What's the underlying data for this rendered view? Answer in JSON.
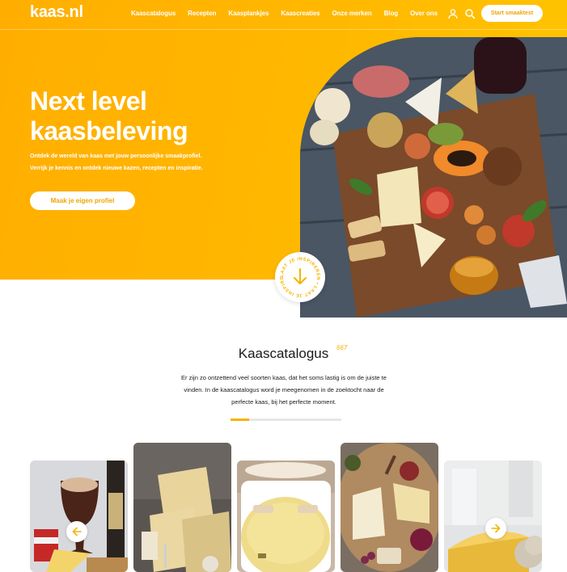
{
  "header": {
    "logo": "kaas.nl",
    "nav": [
      "Kaascatalogus",
      "Recepten",
      "Kaasplankjes",
      "Kaascreaties",
      "Onze merken",
      "Blog",
      "Over ons"
    ],
    "cta_label": "Start smaaktest",
    "icons": [
      "user-icon",
      "search-icon"
    ]
  },
  "hero": {
    "title_line1": "Next level",
    "title_line2": "kaasbeleving",
    "text": "Ontdek de wereld van kaas met jouw persoonlijke smaakprofiel. Verrijk je kennis en ontdek nieuwe kazen, recepten en inspiratie.",
    "button_label": "Maak je eigen profiel",
    "badge_text": "LAAT JE INSPIREREN • LAAT JE INSPIREREN • "
  },
  "catalog": {
    "title": "Kaascatalogus",
    "count": "667",
    "text": "Er zijn zo ontzettend veel soorten kaas, dat het soms lastig is om de juiste te vinden. In de kaascatalogus word je meegenomen in de zoektocht naar de perfecte kaas, bij het perfecte moment.",
    "progress": 0.17
  },
  "colors": {
    "accent": "#ffb400",
    "accent_text": "#f0a500",
    "white": "#ffffff"
  }
}
